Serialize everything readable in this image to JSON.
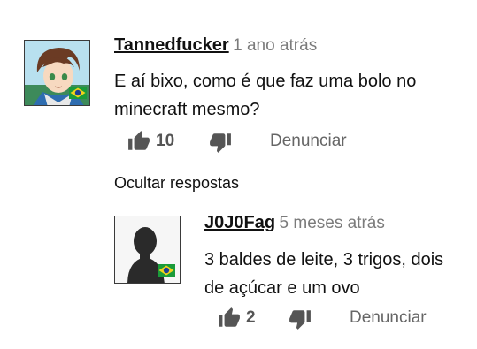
{
  "comment": {
    "author": "Tannedfucker",
    "time": "1 ano atrás",
    "text_lines": [
      "E aí bixo, como é que faz uma bolo no",
      "minecraft mesmo?"
    ],
    "like_count": "10",
    "report_label": "Denunciar"
  },
  "replies_toggle": "Ocultar respostas",
  "reply": {
    "author": "J0J0Fag",
    "time": "5 meses atrás",
    "text_lines": [
      "3 baldes de leite, 3 trigos, dois",
      "de açúcar e um ovo"
    ],
    "like_count": "2",
    "report_label": "Denunciar"
  },
  "icons": {
    "like": "thumbs-up-icon",
    "dislike": "thumbs-down-icon",
    "flag": "brazil-flag-icon"
  },
  "colors": {
    "icon": "#555555",
    "time": "#7b7b7b",
    "flag_green": "#1a9b3a",
    "flag_yellow": "#f2d21b",
    "flag_blue": "#1c3f94"
  }
}
